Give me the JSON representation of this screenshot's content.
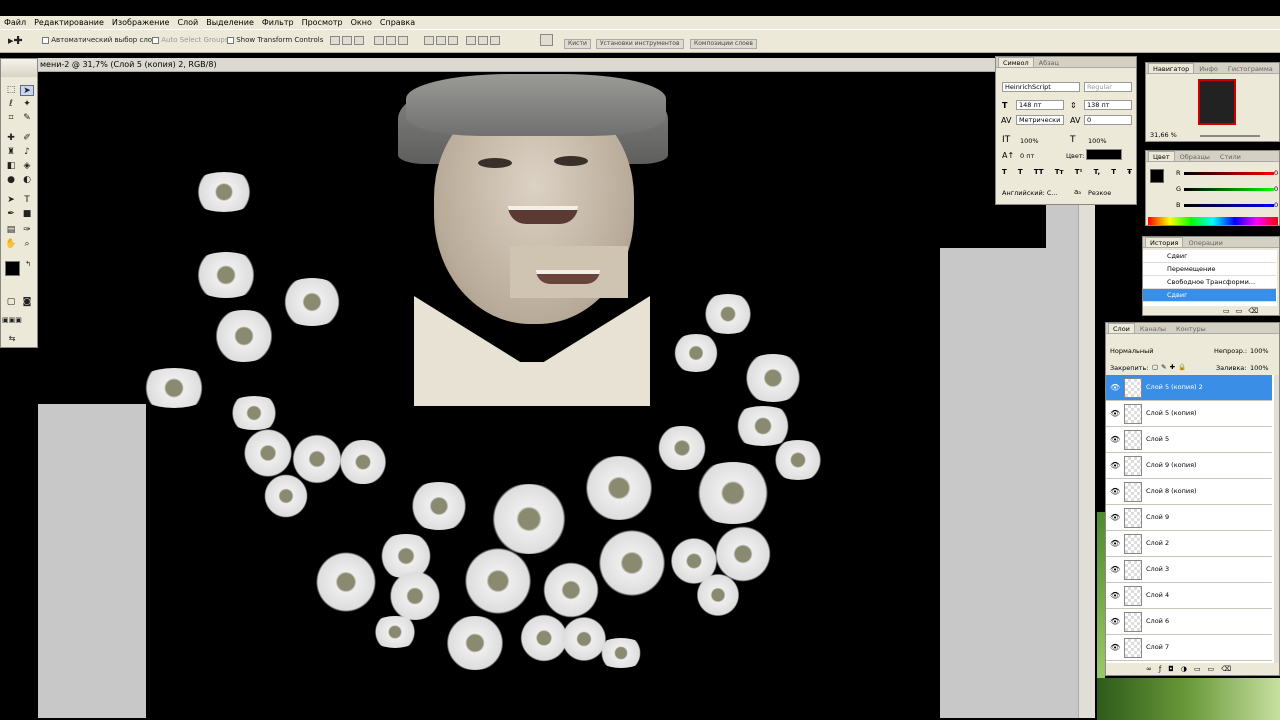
{
  "menu": [
    "Файл",
    "Редактирование",
    "Изображение",
    "Слой",
    "Выделение",
    "Фильтр",
    "Просмотр",
    "Окно",
    "Справка"
  ],
  "options": {
    "auto_select": "Автоматический выбор слоя",
    "auto_select_groups": "Auto Select Groups",
    "show_transform": "Show Transform Controls",
    "well_tabs": [
      "Кисти",
      "Установки инструментов",
      "Композиции слоев"
    ]
  },
  "document": {
    "title": "мени-2 @ 31,7% (Слой 5 (копия) 2, RGB/8)"
  },
  "character": {
    "tabs": [
      "Символ",
      "Абзац"
    ],
    "font_family": "HeinrichScript",
    "font_style": "Regular",
    "size": "148 пт",
    "leading": "138 пт",
    "kerning": "Метрически",
    "tracking": "0",
    "vscale": "100%",
    "hscale": "100%",
    "baseline": "0 пт",
    "color_label": "Цвет:",
    "language": "Английский: С...",
    "aa": "Резкое",
    "style_buttons": [
      "T",
      "T",
      "TT",
      "Tт",
      "T¹",
      "T,",
      "T",
      "Ŧ"
    ]
  },
  "navigator": {
    "tabs": [
      "Навигатор",
      "Инфо",
      "Гистограмма"
    ],
    "zoom": "31,66 %"
  },
  "color": {
    "tabs": [
      "Цвет",
      "Образцы",
      "Стили"
    ],
    "r": "0",
    "g": "0",
    "b": "0",
    "r_label": "R",
    "g_label": "G",
    "b_label": "B"
  },
  "history": {
    "tabs": [
      "История",
      "Операции"
    ],
    "items": [
      "Сдвиг",
      "Перемещение",
      "Свободное Трансформи...",
      "Сдвиг"
    ]
  },
  "layers": {
    "tabs": [
      "Слои",
      "Каналы",
      "Контуры"
    ],
    "blend": "Нормальный",
    "opacity_label": "Непрозр.:",
    "opacity": "100%",
    "lock_label": "Закрепить:",
    "fill_label": "Заливка:",
    "fill": "100%",
    "items": [
      "Слой 5 (копия) 2",
      "Слой 5 (копия)",
      "Слой 5",
      "Слой 9 (копия)",
      "Слой 8 (копия)",
      "Слой 9",
      "Слой 2",
      "Слой 3",
      "Слой 4",
      "Слой 6",
      "Слой 7"
    ]
  },
  "colors": {
    "selection": "#3a8ee6",
    "panel_bg": "#ece9d8"
  }
}
